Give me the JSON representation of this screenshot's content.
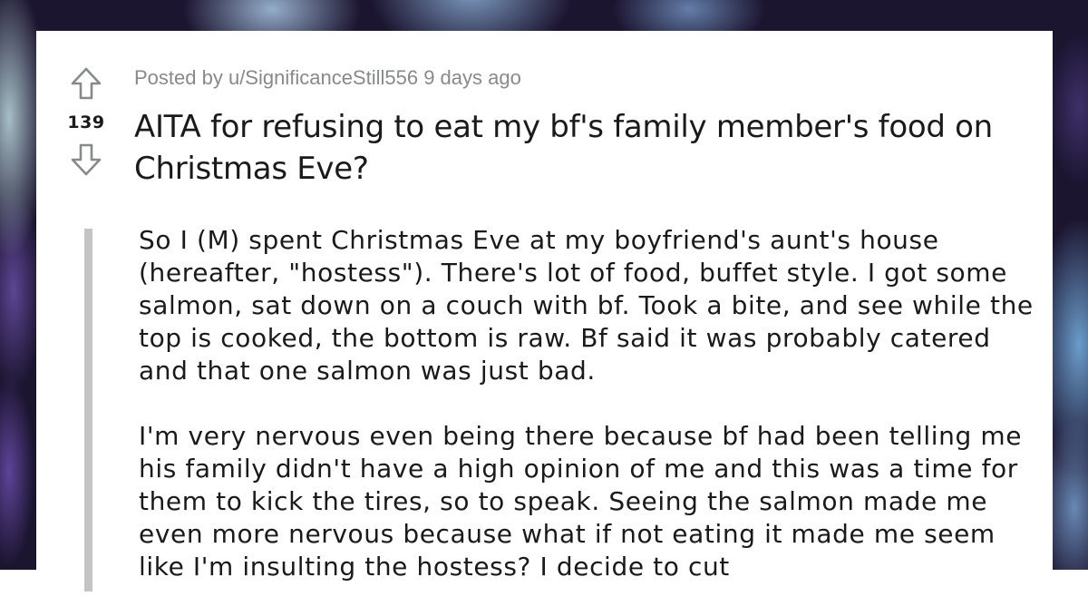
{
  "post": {
    "meta_prefix": "Posted by ",
    "username": "u/SignificanceStill556",
    "age": " 9 days ago",
    "title": "AITA for refusing to eat my bf's family member's food on Christmas Eve?",
    "vote_count": "139",
    "icons": {
      "upvote": "upvote-arrow-icon",
      "downvote": "downvote-arrow-icon"
    },
    "paragraphs": [
      "So I (M) spent Christmas Eve at my boyfriend's aunt's house (hereafter, \"hostess\"). There's lot of food, buffet style. I got some salmon, sat down on a couch with bf. Took a bite, and see while the top is cooked, the bottom is raw. Bf said it was probably catered and that one salmon was just bad.",
      "I'm very nervous even being there because bf had been telling me his family didn't have a high opinion of me and this was a time for them to kick the tires, so to speak. Seeing the salmon made me even more nervous because what if not eating it made me seem like I'm insulting the hostess? I decide to cut"
    ]
  },
  "colors": {
    "text": "#1a1a1b",
    "meta": "#878a8c",
    "icon_stroke": "#878a8c",
    "quote_bar": "#c4c4c4",
    "card": "#ffffff"
  }
}
